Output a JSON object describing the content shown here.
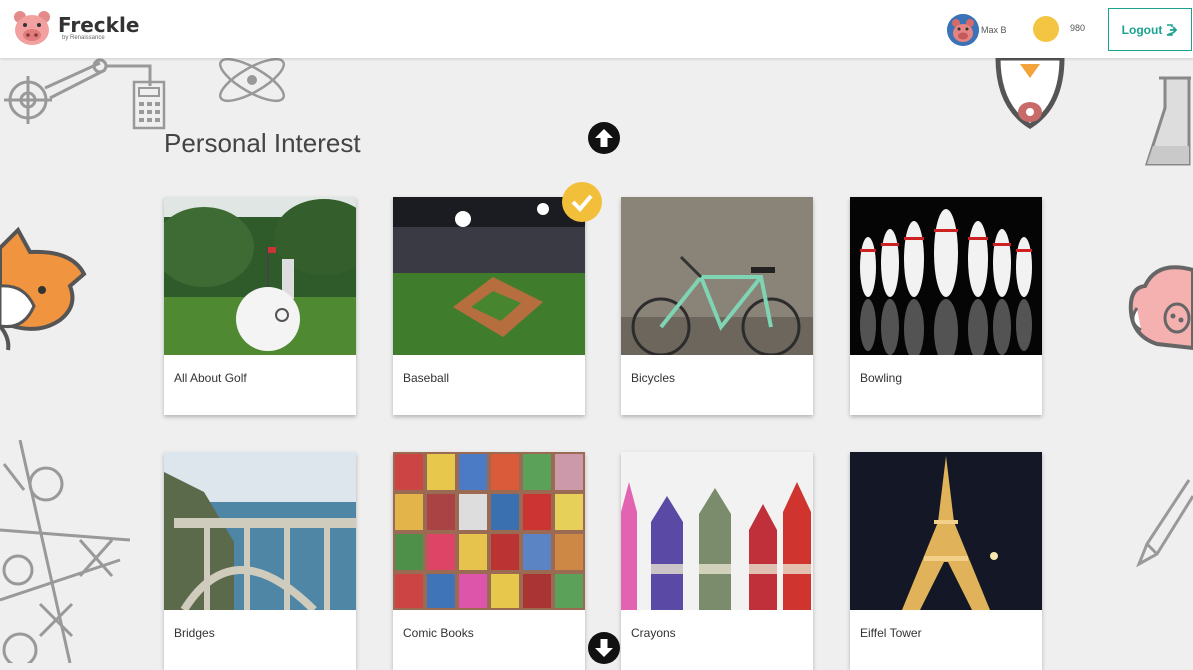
{
  "header": {
    "brand": "Freckle",
    "brand_sub": "by Renaissance",
    "user_name": "Max B",
    "coins": "980",
    "logout_label": "Logout"
  },
  "page": {
    "title": "Personal Interest"
  },
  "topics": [
    {
      "label": "All About Golf",
      "selected": false
    },
    {
      "label": "Baseball",
      "selected": true
    },
    {
      "label": "Bicycles",
      "selected": false
    },
    {
      "label": "Bowling",
      "selected": false
    },
    {
      "label": "Bridges",
      "selected": false
    },
    {
      "label": "Comic Books",
      "selected": false
    },
    {
      "label": "Crayons",
      "selected": false
    },
    {
      "label": "Eiffel Tower",
      "selected": false
    }
  ],
  "colors": {
    "accent": "#19a38f",
    "coin": "#f4c542",
    "check": "#f2bf3a",
    "background": "#efefef"
  },
  "icons": [
    "pig-logo-icon",
    "coin-icon",
    "logout-icon",
    "arrow-up-icon",
    "arrow-down-icon",
    "checkmark-icon"
  ]
}
